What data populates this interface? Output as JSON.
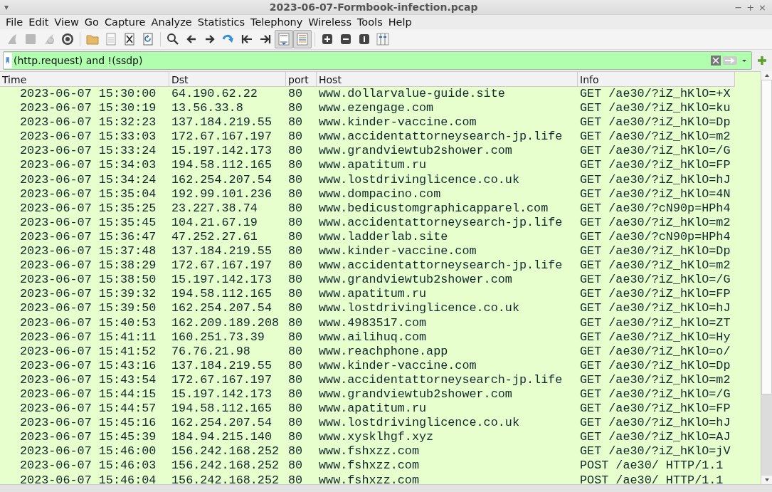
{
  "window": {
    "title": "2023-06-07-Formbook-infection.pcap",
    "menu_glyph": "▾",
    "controls": [
      "−",
      "+",
      "×"
    ]
  },
  "menu": [
    "File",
    "Edit",
    "View",
    "Go",
    "Capture",
    "Analyze",
    "Statistics",
    "Telephony",
    "Wireless",
    "Tools",
    "Help"
  ],
  "toolbar": [
    {
      "kind": "fin",
      "disabled": true,
      "pressed": false
    },
    {
      "kind": "stop",
      "disabled": true,
      "pressed": false
    },
    {
      "kind": "restart",
      "disabled": true,
      "pressed": false
    },
    {
      "kind": "gear",
      "disabled": false,
      "pressed": false
    },
    {
      "kind": "sep"
    },
    {
      "kind": "folder",
      "disabled": false,
      "pressed": false
    },
    {
      "kind": "doc",
      "disabled": false,
      "pressed": false
    },
    {
      "kind": "closefile",
      "disabled": false,
      "pressed": false
    },
    {
      "kind": "reload",
      "disabled": false,
      "pressed": false
    },
    {
      "kind": "sep"
    },
    {
      "kind": "search",
      "disabled": false,
      "pressed": false
    },
    {
      "kind": "left",
      "disabled": false,
      "pressed": false
    },
    {
      "kind": "right",
      "disabled": false,
      "pressed": false
    },
    {
      "kind": "jump",
      "disabled": false,
      "pressed": false
    },
    {
      "kind": "first",
      "disabled": false,
      "pressed": false
    },
    {
      "kind": "last",
      "disabled": false,
      "pressed": false
    },
    {
      "kind": "autoscroll",
      "disabled": false,
      "pressed": true
    },
    {
      "kind": "colorize",
      "disabled": false,
      "pressed": true
    },
    {
      "kind": "sep"
    },
    {
      "kind": "zoomin",
      "disabled": false,
      "pressed": false
    },
    {
      "kind": "zoomout",
      "disabled": false,
      "pressed": false
    },
    {
      "kind": "zoomreset",
      "disabled": false,
      "pressed": false
    },
    {
      "kind": "columns",
      "disabled": false,
      "pressed": false
    }
  ],
  "filter": {
    "value": "(http.request) and !(ssdp)"
  },
  "table": {
    "columns": [
      "Time",
      "Dst",
      "port",
      "Host",
      "Info"
    ],
    "rows": [
      [
        "2023-06-07 15:30:00",
        "64.190.62.22",
        "80",
        "www.dollarvalue-guide.site",
        "GET /ae30/?iZ_hKlO=+X"
      ],
      [
        "2023-06-07 15:30:19",
        "13.56.33.8",
        "80",
        "www.ezengage.com",
        "GET /ae30/?iZ_hKlO=ku"
      ],
      [
        "2023-06-07 15:32:23",
        "137.184.219.55",
        "80",
        "www.kinder-vaccine.com",
        "GET /ae30/?iZ_hKlO=Dp"
      ],
      [
        "2023-06-07 15:33:03",
        "172.67.167.197",
        "80",
        "www.accidentattorneysearch-jp.life",
        "GET /ae30/?iZ_hKlO=m2"
      ],
      [
        "2023-06-07 15:33:24",
        "15.197.142.173",
        "80",
        "www.grandviewtub2shower.com",
        "GET /ae30/?iZ_hKlO=/G"
      ],
      [
        "2023-06-07 15:34:03",
        "194.58.112.165",
        "80",
        "www.apatitum.ru",
        "GET /ae30/?iZ_hKlO=FP"
      ],
      [
        "2023-06-07 15:34:24",
        "162.254.207.54",
        "80",
        "www.lostdrivinglicence.co.uk",
        "GET /ae30/?iZ_hKlO=hJ"
      ],
      [
        "2023-06-07 15:35:04",
        "192.99.101.236",
        "80",
        "www.dompacino.com",
        "GET /ae30/?iZ_hKlO=4N"
      ],
      [
        "2023-06-07 15:35:25",
        "23.227.38.74",
        "80",
        "www.bedicustomgraphicapparel.com",
        "GET /ae30/?cN90p=HPh4"
      ],
      [
        "2023-06-07 15:35:45",
        "104.21.67.19",
        "80",
        "www.accidentattorneysearch-jp.life",
        "GET /ae30/?iZ_hKlO=m2"
      ],
      [
        "2023-06-07 15:36:47",
        "47.252.27.61",
        "80",
        "www.ladderlab.site",
        "GET /ae30/?cN90p=HPh4"
      ],
      [
        "2023-06-07 15:37:48",
        "137.184.219.55",
        "80",
        "www.kinder-vaccine.com",
        "GET /ae30/?iZ_hKlO=Dp"
      ],
      [
        "2023-06-07 15:38:29",
        "172.67.167.197",
        "80",
        "www.accidentattorneysearch-jp.life",
        "GET /ae30/?iZ_hKlO=m2"
      ],
      [
        "2023-06-07 15:38:50",
        "15.197.142.173",
        "80",
        "www.grandviewtub2shower.com",
        "GET /ae30/?iZ_hKlO=/G"
      ],
      [
        "2023-06-07 15:39:32",
        "194.58.112.165",
        "80",
        "www.apatitum.ru",
        "GET /ae30/?iZ_hKlO=FP"
      ],
      [
        "2023-06-07 15:39:50",
        "162.254.207.54",
        "80",
        "www.lostdrivinglicence.co.uk",
        "GET /ae30/?iZ_hKlO=hJ"
      ],
      [
        "2023-06-07 15:40:53",
        "162.209.189.208",
        "80",
        "www.4983517.com",
        "GET /ae30/?iZ_hKlO=ZT"
      ],
      [
        "2023-06-07 15:41:11",
        "160.251.73.39",
        "80",
        "www.ailihuq.com",
        "GET /ae30/?iZ_hKlO=Hy"
      ],
      [
        "2023-06-07 15:41:52",
        "76.76.21.98",
        "80",
        "www.reachphone.app",
        "GET /ae30/?iZ_hKlO=o/"
      ],
      [
        "2023-06-07 15:43:16",
        "137.184.219.55",
        "80",
        "www.kinder-vaccine.com",
        "GET /ae30/?iZ_hKlO=Dp"
      ],
      [
        "2023-06-07 15:43:54",
        "172.67.167.197",
        "80",
        "www.accidentattorneysearch-jp.life",
        "GET /ae30/?iZ_hKlO=m2"
      ],
      [
        "2023-06-07 15:44:15",
        "15.197.142.173",
        "80",
        "www.grandviewtub2shower.com",
        "GET /ae30/?iZ_hKlO=/G"
      ],
      [
        "2023-06-07 15:44:57",
        "194.58.112.165",
        "80",
        "www.apatitum.ru",
        "GET /ae30/?iZ_hKlO=FP"
      ],
      [
        "2023-06-07 15:45:16",
        "162.254.207.54",
        "80",
        "www.lostdrivinglicence.co.uk",
        "GET /ae30/?iZ_hKlO=hJ"
      ],
      [
        "2023-06-07 15:45:39",
        "184.94.215.140",
        "80",
        "www.xysklhgf.xyz",
        "GET /ae30/?iZ_hKlO=AJ"
      ],
      [
        "2023-06-07 15:46:00",
        "156.242.168.252",
        "80",
        "www.fshxzz.com",
        "GET /ae30/?iZ_hKlO=jV"
      ],
      [
        "2023-06-07 15:46:03",
        "156.242.168.252",
        "80",
        "www.fshxzz.com",
        "POST /ae30/ HTTP/1.1"
      ],
      [
        "2023-06-07 15:46:04",
        "156.242.168.252",
        "80",
        "www.fshxzz.com",
        "POST /ae30/ HTTP/1.1"
      ]
    ]
  }
}
